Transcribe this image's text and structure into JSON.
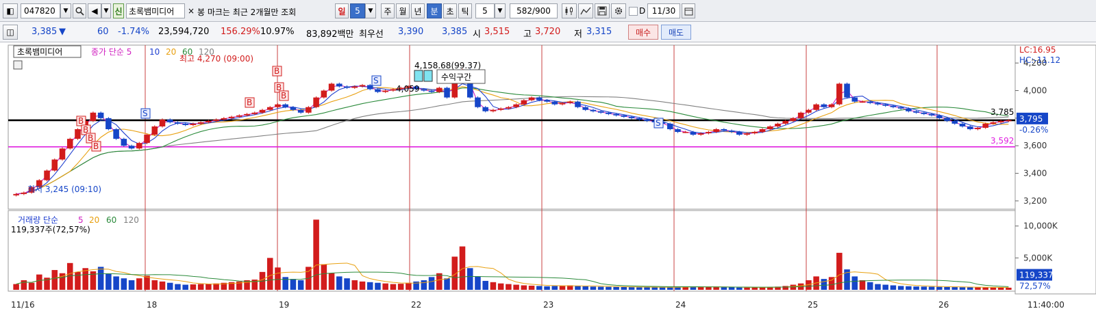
{
  "toolbar": {
    "code": "047820",
    "credit_badge": "신",
    "stock_name": "초록뱀미디어",
    "notice": "봉 마크는 최근 2개월만 조회",
    "period_day": "일",
    "period_num": "5",
    "period_week": "주",
    "period_month": "월",
    "period_year": "년",
    "period_minute": "분",
    "period_second": "초",
    "period_tick": "틱",
    "interval_value": "5",
    "count_value": "582/900",
    "d_label": "D",
    "date_value": "11/30"
  },
  "quote": {
    "price": "3,385",
    "arrow": "▼",
    "change": "60",
    "change_pct": "-1.74%",
    "volume": "23,594,720",
    "volume_ratio": "156.29%",
    "turnover": "10.97%",
    "amount": "83,892백만",
    "best_label": "최우선",
    "best_ask": "3,390",
    "best_bid": "3,385",
    "open_label": "시",
    "open": "3,515",
    "high_label": "고",
    "high": "3,720",
    "low_label": "저",
    "low": "3,315",
    "buy_label": "매수",
    "sell_label": "매도"
  },
  "legend": {
    "name": "초록뱀미디어",
    "price_prefix": "종가 단순",
    "ma": [
      "5",
      "10",
      "20",
      "60",
      "120"
    ],
    "vol_prefix": "거래량 단순",
    "vol_current": "119,337주(72,57%)"
  },
  "annotations": {
    "high": "최고 4,270 (09:00)",
    "low": "최저 3,245 (09:10)",
    "peak": "4,158.68(99.37)",
    "peak2": "4,059",
    "profit_zone": "수익구간",
    "lc": "LC:16.95",
    "hc": "HC:-11.12",
    "last_line": "3,785",
    "magenta_line": "3,592",
    "price_tag": "3,795",
    "pct_tag": "-0.26%",
    "vol_tag": "119,337",
    "vol_pct": "72,57%",
    "time_end": "11:40:00",
    "marker_b": "B",
    "marker_s": "S"
  },
  "colors": {
    "up": "#d21c1c",
    "down": "#1646c8",
    "ma5": "#d020c0",
    "ma10": "#2040d0",
    "ma20": "#e8a010",
    "ma60": "#2a8a3a",
    "ma120": "#808080",
    "session_line": "#c84040",
    "support_line": "#000000",
    "magenta_line": "#e020e0"
  },
  "chart_data": {
    "type": "candlestick",
    "price_axis": {
      "min": 3150,
      "max": 4300,
      "ticks": [
        "4,200",
        "4,000",
        "3,800",
        "3,600",
        "3,400",
        "3,200"
      ],
      "tick_values": [
        4200,
        4000,
        3800,
        3600,
        3400,
        3200
      ]
    },
    "volume_axis": {
      "min": 0,
      "max": 12000,
      "ticks": [
        "10,000K",
        "5,000K"
      ],
      "tick_values": [
        10000,
        5000
      ]
    },
    "date_ticks": [
      "11/16",
      "18",
      "19",
      "22",
      "23",
      "24",
      "25",
      "26"
    ],
    "horizontal_lines": [
      {
        "value": 3785,
        "label": "3,785"
      },
      {
        "value": 3592,
        "label": "3,592"
      }
    ],
    "close_series": [
      3250,
      3260,
      3300,
      3350,
      3420,
      3500,
      3580,
      3650,
      3720,
      3780,
      3840,
      3800,
      3720,
      3650,
      3600,
      3580,
      3620,
      3680,
      3740,
      3790,
      3770,
      3760,
      3750,
      3760,
      3770,
      3780,
      3790,
      3800,
      3810,
      3820,
      3830,
      3840,
      3860,
      3880,
      3900,
      3880,
      3860,
      3840,
      3880,
      3950,
      4000,
      4050,
      4030,
      4020,
      4030,
      4040,
      4010,
      3990,
      4000,
      4010,
      4020,
      4030,
      4010,
      4000,
      3990,
      4020,
      3950,
      4080,
      4150,
      3950,
      3880,
      3850,
      3860,
      3870,
      3880,
      3900,
      3930,
      3950,
      3930,
      3920,
      3900,
      3910,
      3920,
      3880,
      3860,
      3850,
      3840,
      3830,
      3820,
      3810,
      3800,
      3790,
      3780,
      3770,
      3760,
      3720,
      3700,
      3700,
      3680,
      3690,
      3700,
      3720,
      3710,
      3700,
      3680,
      3690,
      3700,
      3720,
      3740,
      3760,
      3780,
      3800,
      3840,
      3860,
      3900,
      3880,
      3900,
      4050,
      3950,
      3920,
      3920,
      3910,
      3900,
      3890,
      3880,
      3870,
      3850,
      3840,
      3830,
      3820,
      3800,
      3780,
      3760,
      3740,
      3720,
      3730,
      3760,
      3770,
      3780,
      3785
    ],
    "volume_series": [
      900,
      1500,
      1100,
      2400,
      1900,
      3100,
      2600,
      4200,
      2800,
      3400,
      2900,
      3600,
      2500,
      2100,
      1800,
      1500,
      1800,
      2200,
      1500,
      1300,
      1100,
      900,
      800,
      850,
      900,
      950,
      1000,
      1100,
      1200,
      1300,
      1500,
      1600,
      2800,
      5000,
      3500,
      2000,
      1700,
      1500,
      3600,
      11000,
      4000,
      2600,
      2100,
      1800,
      1500,
      1300,
      1200,
      1100,
      1000,
      900,
      950,
      1100,
      1300,
      1500,
      2000,
      2600,
      1800,
      5200,
      6800,
      3400,
      2100,
      1400,
      1200,
      1000,
      900,
      800,
      700,
      650,
      600,
      550,
      600,
      650,
      700,
      600,
      550,
      500,
      480,
      460,
      450,
      440,
      420,
      400,
      400,
      380,
      380,
      420,
      460,
      500,
      520,
      480,
      440,
      420,
      400,
      380,
      360,
      360,
      380,
      400,
      450,
      500,
      600,
      800,
      1000,
      1500,
      2100,
      1700,
      2000,
      5800,
      3200,
      2100,
      1500,
      1200,
      900,
      800,
      700,
      600,
      560,
      520,
      500,
      480,
      460,
      440,
      420,
      400,
      400,
      380,
      360,
      360,
      340,
      330
    ]
  }
}
